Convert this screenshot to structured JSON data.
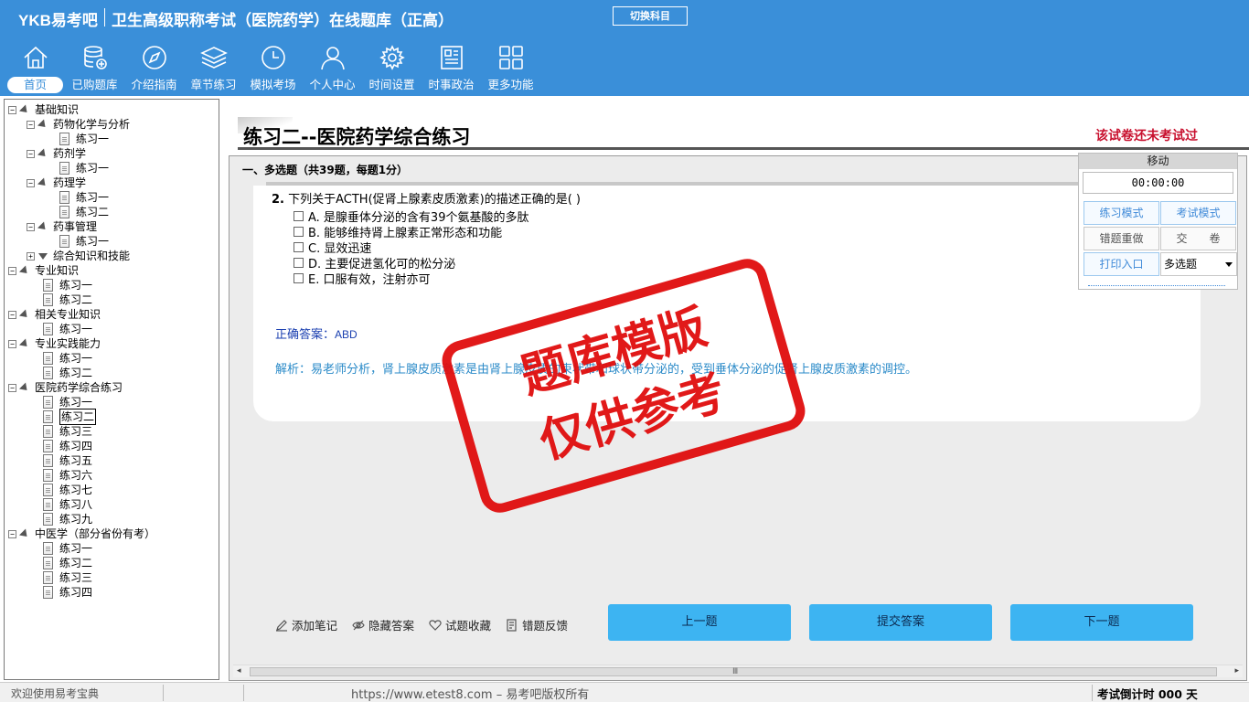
{
  "header": {
    "brand": "YKB易考吧",
    "app_title": "卫生高级职称考试（医院药学）在线题库（正高）",
    "switch_label": "切换科目"
  },
  "nav": [
    {
      "label": "首页",
      "icon": "home-icon"
    },
    {
      "label": "已购题库",
      "icon": "database-icon"
    },
    {
      "label": "介绍指南",
      "icon": "compass-icon"
    },
    {
      "label": "章节练习",
      "icon": "layers-icon"
    },
    {
      "label": "模拟考场",
      "icon": "clock-icon"
    },
    {
      "label": "个人中心",
      "icon": "user-icon"
    },
    {
      "label": "时间设置",
      "icon": "gear-icon"
    },
    {
      "label": "时事政治",
      "icon": "newspaper-icon"
    },
    {
      "label": "更多功能",
      "icon": "grid-icon"
    }
  ],
  "tree": [
    {
      "label": "基础知识",
      "kind": "root"
    },
    {
      "label": "药物化学与分析",
      "kind": "sub"
    },
    {
      "label": "练习一",
      "kind": "leaf2"
    },
    {
      "label": "药剂学",
      "kind": "sub"
    },
    {
      "label": "练习一",
      "kind": "leaf2"
    },
    {
      "label": "药理学",
      "kind": "sub"
    },
    {
      "label": "练习一",
      "kind": "leaf2"
    },
    {
      "label": "练习二",
      "kind": "leaf2"
    },
    {
      "label": "药事管理",
      "kind": "sub"
    },
    {
      "label": "练习一",
      "kind": "leaf2"
    },
    {
      "label": "综合知识和技能",
      "kind": "subclosed"
    },
    {
      "label": "专业知识",
      "kind": "root"
    },
    {
      "label": "练习一",
      "kind": "leaf1"
    },
    {
      "label": "练习二",
      "kind": "leaf1"
    },
    {
      "label": "相关专业知识",
      "kind": "root"
    },
    {
      "label": "练习一",
      "kind": "leaf1"
    },
    {
      "label": "专业实践能力",
      "kind": "root"
    },
    {
      "label": "练习一",
      "kind": "leaf1"
    },
    {
      "label": "练习二",
      "kind": "leaf1"
    },
    {
      "label": "医院药学综合练习",
      "kind": "root"
    },
    {
      "label": "练习一",
      "kind": "leaf1"
    },
    {
      "label": "练习二",
      "kind": "leaf1",
      "selected": true
    },
    {
      "label": "练习三",
      "kind": "leaf1"
    },
    {
      "label": "练习四",
      "kind": "leaf1"
    },
    {
      "label": "练习五",
      "kind": "leaf1"
    },
    {
      "label": "练习六",
      "kind": "leaf1"
    },
    {
      "label": "练习七",
      "kind": "leaf1"
    },
    {
      "label": "练习八",
      "kind": "leaf1"
    },
    {
      "label": "练习九",
      "kind": "leaf1"
    },
    {
      "label": "中医学（部分省份有考）",
      "kind": "root"
    },
    {
      "label": "练习一",
      "kind": "leaf1"
    },
    {
      "label": "练习二",
      "kind": "leaf1"
    },
    {
      "label": "练习三",
      "kind": "leaf1"
    },
    {
      "label": "练习四",
      "kind": "leaf1"
    }
  ],
  "main": {
    "paper_title": "练习二--医院药学综合练习",
    "exam_status": "该试卷还未考试过",
    "section_head": "一、多选题（共39题，每题1分）",
    "question": {
      "number": "2.",
      "text": "下列关于ACTH(促肾上腺素皮质激素)的描述正确的是( )",
      "options": [
        "A. 是腺垂体分泌的含有39个氨基酸的多肽",
        "B. 能够维持肾上腺素正常形态和功能",
        "C. 显效迅速",
        "D. 主要促进氢化可的松分泌",
        "E. 口服有效，注射亦可"
      ],
      "answer_label": "正确答案：",
      "answer_value": "ABD",
      "analysis": "解析：易老师分析，肾上腺皮质激素是由肾上腺皮质的束状带和球状带分泌的，受到垂体分泌的促肾上腺皮质激素的调控。"
    },
    "tools": [
      {
        "label": "添加笔记",
        "icon": "pencil-icon"
      },
      {
        "label": "隐藏答案",
        "icon": "eye-icon"
      },
      {
        "label": "试题收藏",
        "icon": "heart-icon"
      },
      {
        "label": "错题反馈",
        "icon": "feedback-icon"
      }
    ],
    "buttons": {
      "prev": "上一题",
      "submit": "提交答案",
      "next": "下一题"
    }
  },
  "float_panel": {
    "head": "移动",
    "timer": "00:00:00",
    "practice_mode": "练习模式",
    "exam_mode": "考试模式",
    "redo_wrong": "错题重做",
    "hand_in": "交　　卷",
    "print": "打印入口",
    "type_select": "多选题"
  },
  "stamp": {
    "line1": "题库模版",
    "line2": "仅供参考"
  },
  "status": {
    "welcome": "欢迎使用易考宝典",
    "copyright": "https://www.etest8.com – 易考吧版权所有",
    "countdown": "考试倒计时 000 天"
  }
}
